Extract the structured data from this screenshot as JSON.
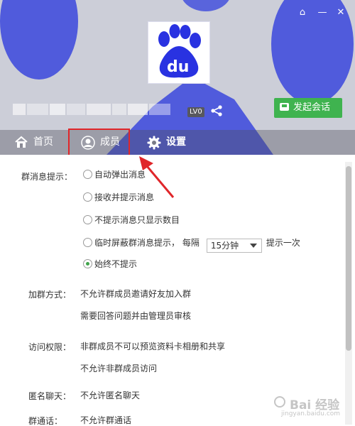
{
  "header": {
    "level_badge": "LV0",
    "start_chat_label": "发起会话"
  },
  "tabs": [
    {
      "label": "首页"
    },
    {
      "label": "成员"
    },
    {
      "label": "设置"
    }
  ],
  "settings": {
    "message_hint": {
      "label": "群消息提示：",
      "options": [
        {
          "label": "自动弹出消息",
          "selected": false
        },
        {
          "label": "接收并提示消息",
          "selected": false
        },
        {
          "label": "不提示消息只显示数目",
          "selected": false
        },
        {
          "label": "临时屏蔽群消息提示，  每隔",
          "selected": false,
          "interval": "15分钟",
          "suffix": "提示一次"
        },
        {
          "label": "始终不提示",
          "selected": true
        }
      ]
    },
    "join_method": {
      "label": "加群方式：",
      "lines": [
        "不允许群成员邀请好友加入群",
        "需要回答问题并由管理员审核"
      ]
    },
    "access": {
      "label": "访问权限：",
      "lines": [
        "非群成员不可以预览资料卡相册和共享",
        "不允许非群成员访问"
      ]
    },
    "anonymous": {
      "label": "匿名聊天：",
      "value": "不允许匿名聊天"
    },
    "group_call": {
      "label": "群通话：",
      "value": "不允许群通话"
    }
  },
  "watermark": {
    "text": "Bai 经验",
    "sub": "jingyan.baidu.com"
  },
  "colors": {
    "accent_green": "#3fb34f",
    "highlight_red": "#e0262a",
    "paw_blue": "#2932e1"
  }
}
